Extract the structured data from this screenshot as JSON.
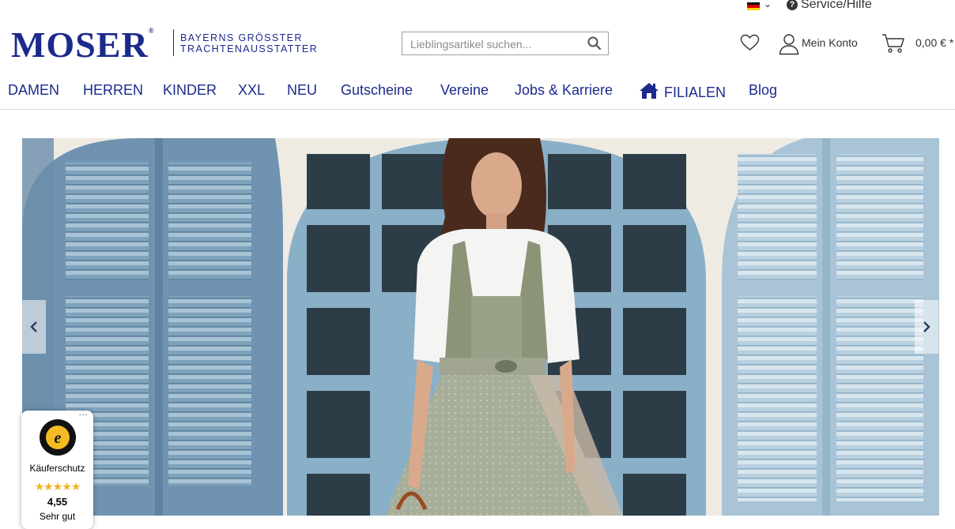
{
  "topbar": {
    "language_flag": "germany-flag",
    "service_label": "Service/Hilfe"
  },
  "brand": {
    "logo_text": "MOSER",
    "registered": "®",
    "tagline_line1": "BAYERNS GRÖSSTER",
    "tagline_line2": "TRACHTENAUSSTATTER",
    "color": "#1c2a8c"
  },
  "search": {
    "placeholder": "Lieblingsartikel suchen...",
    "value": ""
  },
  "header_actions": {
    "account_label": "Mein Konto",
    "cart_label": "0,00 € *"
  },
  "nav": {
    "items": [
      {
        "label": "DAMEN"
      },
      {
        "label": "HERREN"
      },
      {
        "label": "KINDER"
      },
      {
        "label": "XXL"
      },
      {
        "label": "NEU"
      },
      {
        "label": "Gutscheine"
      },
      {
        "label": "Vereine"
      },
      {
        "label": "Jobs & Karriere"
      },
      {
        "label": "FILIALEN",
        "icon": "home-icon"
      },
      {
        "label": "Blog"
      }
    ]
  },
  "hero": {
    "image": "woman-in-dirndl-photo"
  },
  "trust_badge": {
    "label": "Käuferschutz",
    "stars": "★★★★★",
    "score": "4,55",
    "grade": "Sehr gut",
    "seal_letter": "e"
  }
}
